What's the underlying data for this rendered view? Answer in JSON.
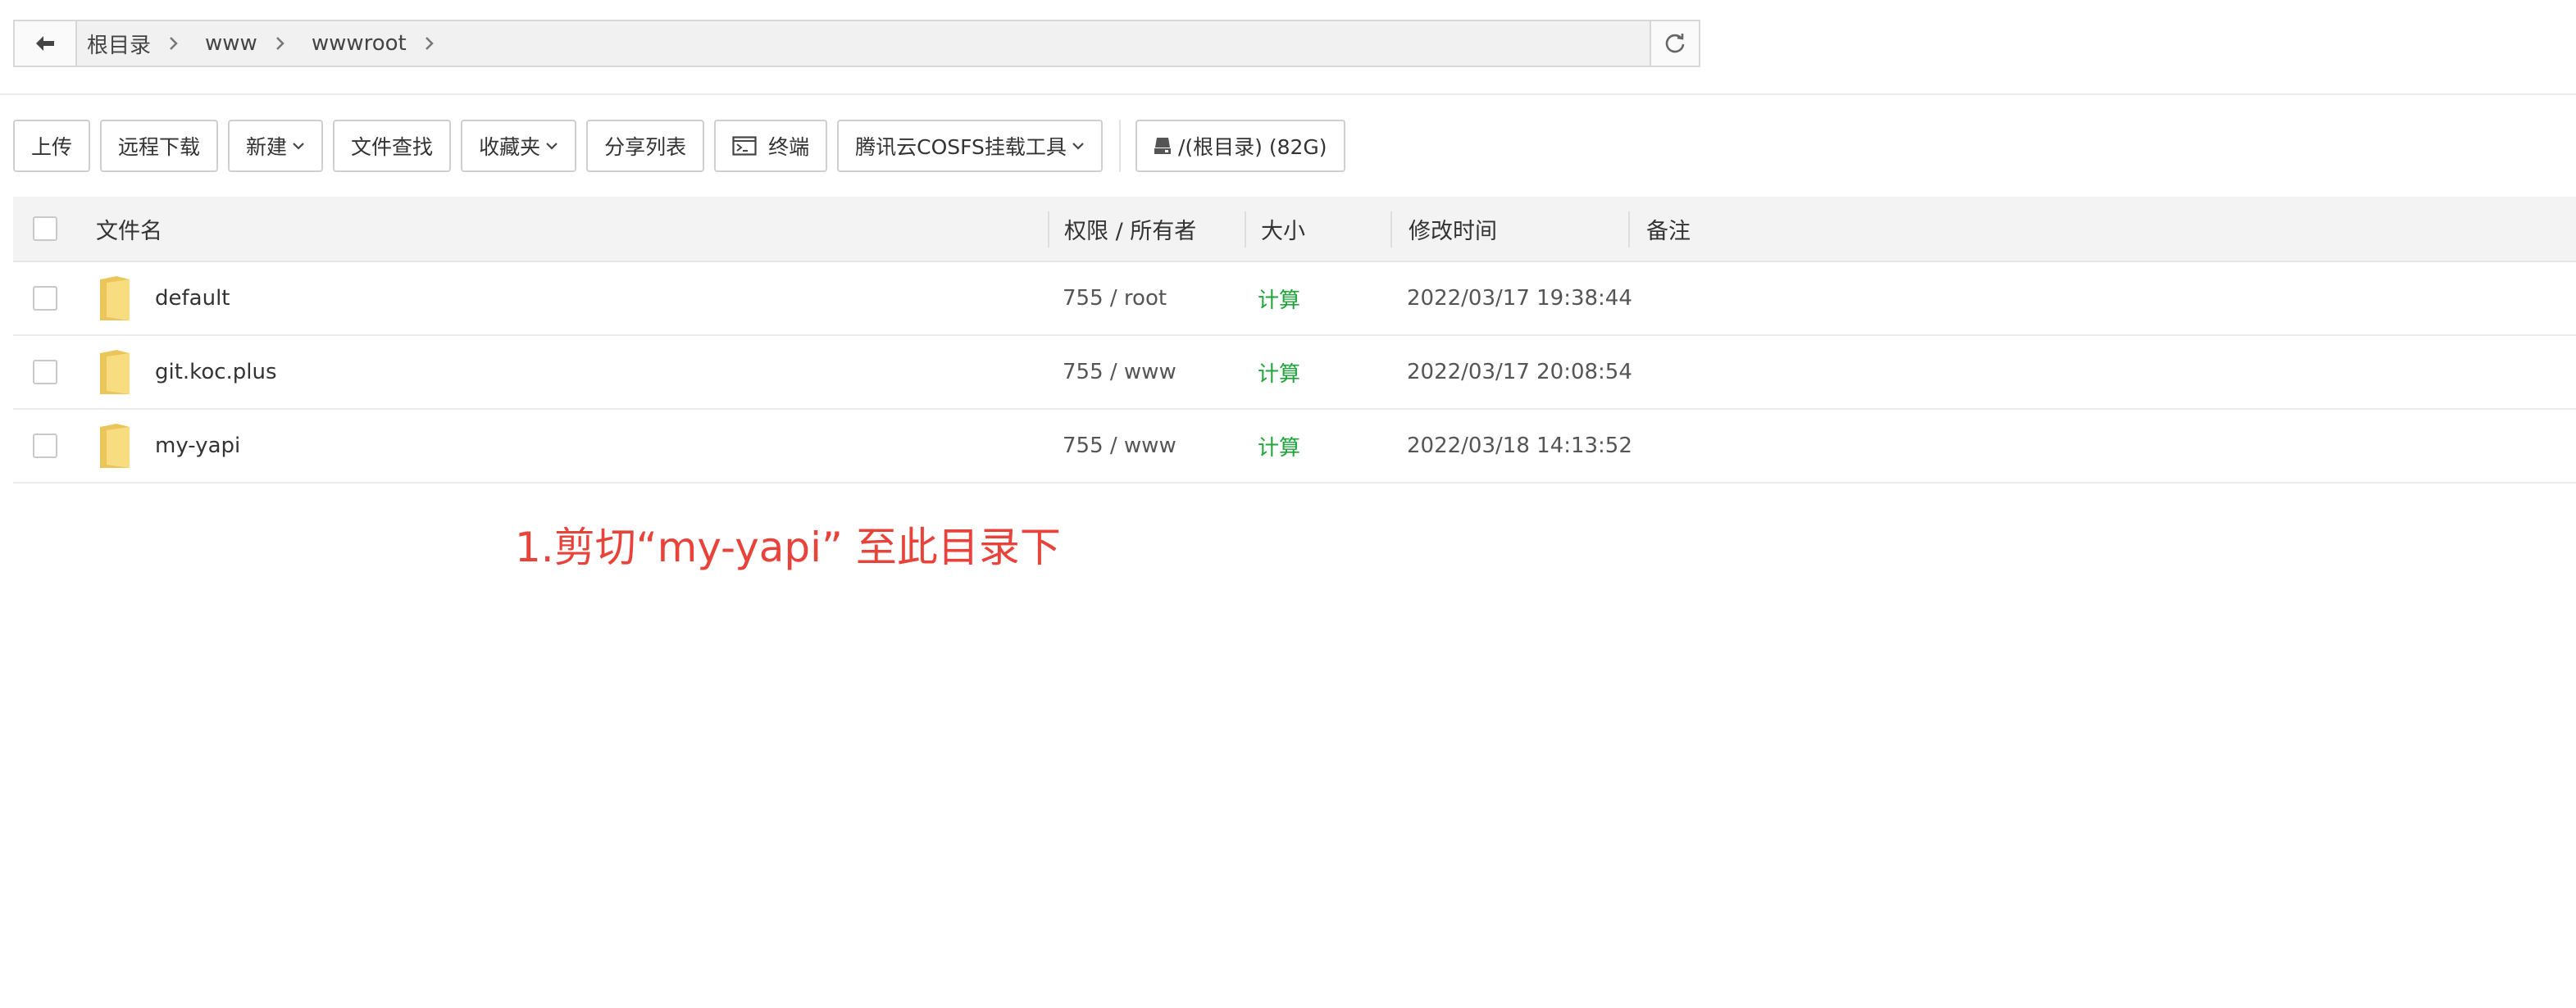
{
  "pathbar": {
    "back_icon": "arrow-left-icon",
    "refresh_icon": "refresh-icon",
    "crumbs": [
      "根目录",
      "www",
      "wwwroot"
    ]
  },
  "toolbar": {
    "upload": "上传",
    "remote_download": "远程下载",
    "new": "新建",
    "file_search": "文件查找",
    "favorites": "收藏夹",
    "share_list": "分享列表",
    "terminal": "终端",
    "cosfs_tool": "腾讯云COSFS挂载工具",
    "disk": "/(根目录) (82G)"
  },
  "table": {
    "headers": {
      "name": "文件名",
      "perm": "权限 / 所有者",
      "size": "大小",
      "mtime": "修改时间",
      "remark": "备注"
    },
    "rows": [
      {
        "name": "default",
        "perm": "755 / root",
        "size": "计算",
        "mtime": "2022/03/17 19:38:44"
      },
      {
        "name": "git.koc.plus",
        "perm": "755 / www",
        "size": "计算",
        "mtime": "2022/03/17 20:08:54"
      },
      {
        "name": "my-yapi",
        "perm": "755 / www",
        "size": "计算",
        "mtime": "2022/03/18 14:13:52"
      }
    ]
  },
  "annotation": "1.剪切“my-yapi” 至此目录下",
  "colors": {
    "size_link": "#20a53a",
    "annotation": "#e8433b",
    "folder": "#f5d572"
  }
}
